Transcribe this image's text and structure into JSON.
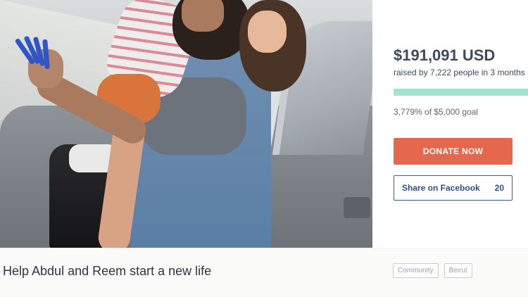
{
  "campaign": {
    "title": "Help Abdul and Reem start a new life",
    "tags": [
      "Community",
      "Beirut"
    ]
  },
  "donation": {
    "amount": "$191,091 USD",
    "raised_text": "raised by 7,222 people in 3 months",
    "progress_fraction": 1.0,
    "goal_text": "3,779% of $5,000 goal",
    "donate_label": "DONATE NOW",
    "share_label": "Share on Facebook",
    "share_count": "20"
  },
  "colors": {
    "accent": "#e5674d",
    "progress": "#a4e3cf",
    "facebook": "#2d4f8f",
    "text": "#3d4a5c"
  }
}
